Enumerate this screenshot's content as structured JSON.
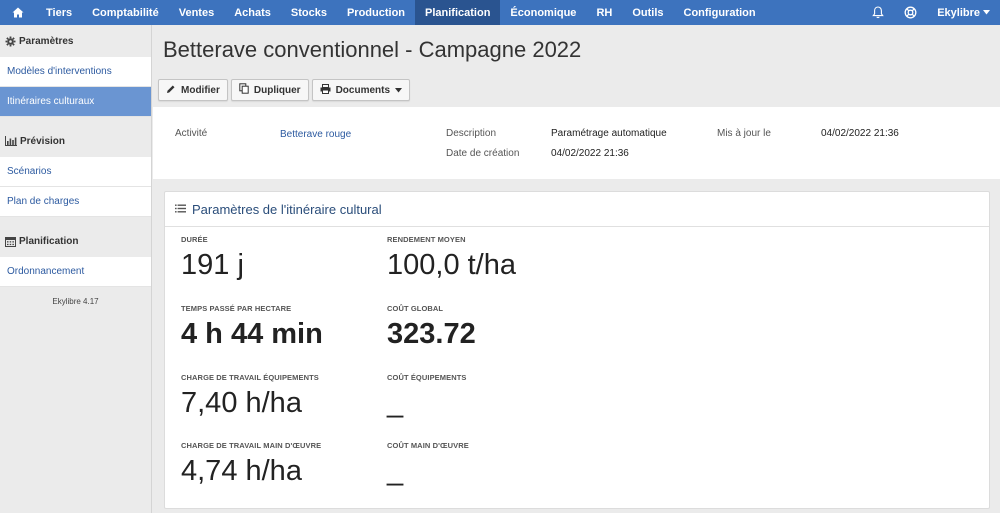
{
  "nav": {
    "items": [
      "Tiers",
      "Comptabilité",
      "Ventes",
      "Achats",
      "Stocks",
      "Production",
      "Planification",
      "Économique",
      "RH",
      "Outils",
      "Configuration"
    ],
    "active": "Planification",
    "user": "Ekylibre",
    "icons": {
      "home": "home-icon",
      "bell": "bell-icon",
      "help": "lifebuoy-icon",
      "caret": "caret-down-icon"
    }
  },
  "sidebar": {
    "sections": [
      {
        "title": "Paramètres",
        "icon": "gear-icon",
        "items": [
          "Modèles d'interventions",
          "Itinéraires culturaux"
        ]
      },
      {
        "title": "Prévision",
        "icon": "bar-chart-icon",
        "items": [
          "Scénarios",
          "Plan de charges"
        ]
      },
      {
        "title": "Planification",
        "icon": "calendar-icon",
        "items": [
          "Ordonnancement"
        ]
      }
    ],
    "active_item": "Itinéraires culturaux",
    "version": "Ekylibre 4.17"
  },
  "page": {
    "title": "Betterave conventionnel - Campagne 2022"
  },
  "toolbar": {
    "edit_label": "Modifier",
    "duplicate_label": "Dupliquer",
    "documents_label": "Documents"
  },
  "info": {
    "activity_label": "Activité",
    "activity_value": "Betterave rouge",
    "description_label": "Description",
    "description_value": "Paramétrage automatique",
    "created_label": "Date de création",
    "created_value": "04/02/2022 21:36",
    "updated_label": "Mis à jour le",
    "updated_value": "04/02/2022 21:36"
  },
  "card": {
    "title": "Paramètres de l'itinéraire cultural",
    "metrics": [
      {
        "label": "DURÉE",
        "value": "191 j"
      },
      {
        "label": "RENDEMENT MOYEN",
        "value": "100,0 t/ha"
      },
      {
        "label": "TEMPS PASSÉ PAR HECTARE",
        "value": "4 h 44 min"
      },
      {
        "label": "COÛT GLOBAL",
        "value": "323.72"
      },
      {
        "label": "CHARGE DE TRAVAIL ÉQUIPEMENTS",
        "value": "7,40 h/ha"
      },
      {
        "label": "COÛT ÉQUIPEMENTS",
        "value": "_"
      },
      {
        "label": "CHARGE DE TRAVAIL MAIN D'ŒUVRE",
        "value": "4,74 h/ha"
      },
      {
        "label": "COÛT MAIN D'ŒUVRE",
        "value": "_"
      }
    ]
  }
}
